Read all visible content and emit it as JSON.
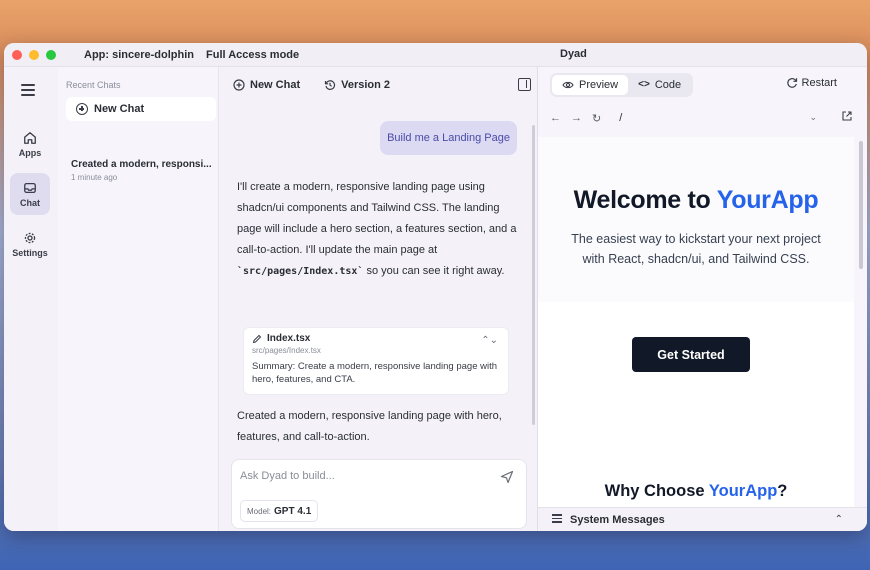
{
  "titlebar": {
    "app": "App: sincere-dolphin",
    "mode": "Full Access mode",
    "title": "Dyad"
  },
  "rail": {
    "apps": "Apps",
    "chat": "Chat",
    "settings": "Settings"
  },
  "chatlist": {
    "heading": "Recent Chats",
    "new_chat": "New Chat",
    "items": [
      {
        "title": "Created a modern, responsi...",
        "time": "1 minute ago"
      }
    ]
  },
  "chat": {
    "new_chat": "New Chat",
    "version": "Version 2",
    "user_message": "Build me a Landing Page",
    "assistant_p1_a": "I'll create a modern, responsive landing page using shadcn/ui components and Tailwind CSS. The landing page will include a hero section, a features section, and a call-to-action. I'll update the main page at ",
    "assistant_code": "`src/pages/Index.tsx`",
    "assistant_p1_b": " so you can see it right away.",
    "file_card": {
      "name": "Index.tsx",
      "path": "src/pages/Index.tsx",
      "summary": "Summary: Create a modern, responsive landing page with hero, features, and CTA."
    },
    "assistant_p2": "Created a modern, responsive landing page with hero, features, and call-to-action.",
    "composer_placeholder": "Ask Dyad to build...",
    "model_label": "Model:",
    "model_value": "GPT 4.1"
  },
  "preview": {
    "tab_preview": "Preview",
    "tab_code": "Code",
    "restart": "Restart",
    "url": "/",
    "hero_title_plain": "Welcome to ",
    "hero_title_accent": "YourApp",
    "hero_subtitle_1": "The easiest way to kickstart your next project",
    "hero_subtitle_2": "with React, shadcn/ui, and Tailwind CSS.",
    "cta": "Get Started",
    "why_plain": "Why Choose ",
    "why_accent": "YourApp",
    "why_end": "?",
    "system_messages": "System Messages"
  },
  "colors": {
    "accent": "#2563eb",
    "user_bubble": "#dcd9f3",
    "cta_bg": "#111827"
  }
}
